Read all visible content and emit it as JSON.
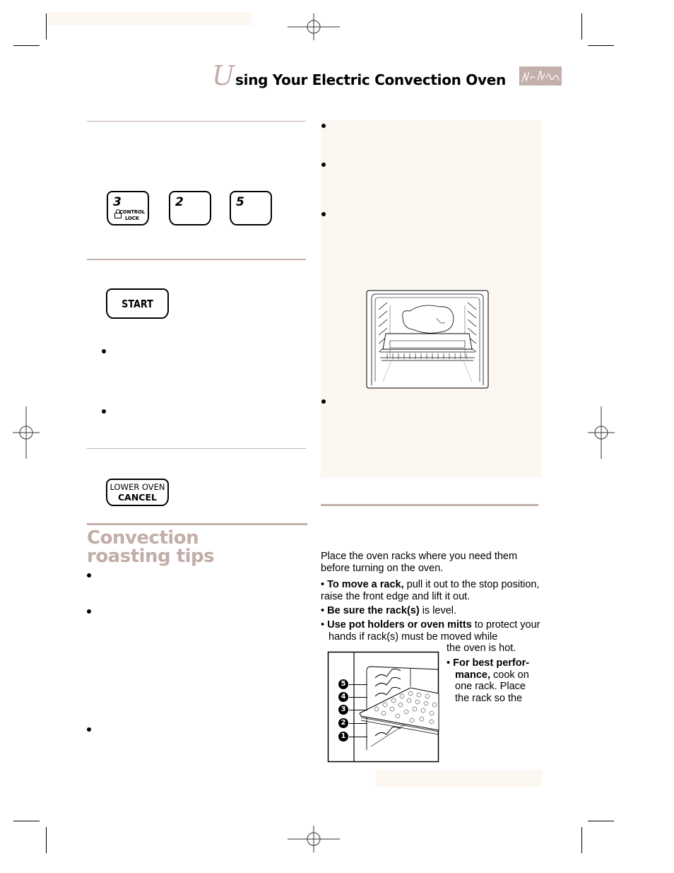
{
  "header": {
    "title_initial": "U",
    "title_rest": "sing Your Electric Convection Oven",
    "signature_icon": "signature-logo"
  },
  "colors": {
    "accent": "#c4b0ab",
    "title_accent": "#c2ada8",
    "panel_cream": "#fdf7f1",
    "text": "#000000"
  },
  "keypad": {
    "keys": [
      {
        "number": "3",
        "sub_line1": "CONTROL",
        "sub_line2": "LOCK",
        "icon": "lock-icon"
      },
      {
        "number": "2"
      },
      {
        "number": "5"
      }
    ],
    "start_label": "START",
    "cancel_line1": "LOWER OVEN",
    "cancel_line2": "CANCEL"
  },
  "roasting_tips": {
    "title_line1": "Convection",
    "title_line2": "roasting tips"
  },
  "rack_section": {
    "intro": "Place the oven racks where you need them before turning on the oven.",
    "items": [
      {
        "bold": "To move a rack,",
        "rest": " pull it out to the stop position, raise the front edge and lift it out."
      },
      {
        "bold": "Be sure the rack(s)",
        "rest": " is level."
      },
      {
        "bold": "Use pot holders or oven mitts",
        "rest": " to protect your hands if rack(s) must be moved while"
      },
      {
        "bold": "",
        "rest": "the oven is hot."
      }
    ],
    "best_performance": {
      "bold_line1": "For best perfor-",
      "bold_line2": "mance,",
      "rest_line2": " cook on",
      "line3": "one rack. Place",
      "line4": "the rack so the"
    },
    "rack_positions": [
      "5",
      "4",
      "3",
      "2",
      "1"
    ]
  }
}
